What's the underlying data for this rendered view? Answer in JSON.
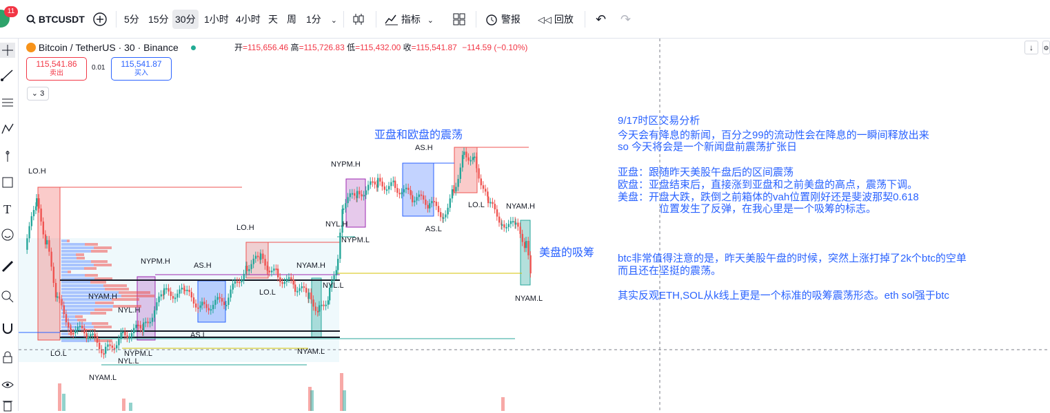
{
  "toolbar": {
    "notification_count": "11",
    "symbol": "BTCUSDT",
    "intervals": [
      "5分",
      "15分",
      "30分",
      "1小时",
      "4小时",
      "天",
      "周"
    ],
    "selected_interval": "30分",
    "interval_dropdown": "1分",
    "indicators_label": "指标",
    "alert_label": "警报",
    "replay_label": "回放"
  },
  "legend": {
    "pair": "Bitcoin / TetherUS · 30 · Binance",
    "open_label": "开",
    "open": "=115,656.46",
    "high_label": "高",
    "high": "=115,726.83",
    "low_label": "低",
    "low": "=115,432.00",
    "close_label": "收",
    "close": "=115,541.87",
    "change": "−114.59 (−0.10%)"
  },
  "trade": {
    "sell_price": "115,541.86",
    "sell_label": "卖出",
    "spread": "0.01",
    "buy_price": "115,541.87",
    "buy_label": "买入",
    "collapse_count": "3"
  },
  "annotations": {
    "chart_title": "亚盘和欧盘的震荡",
    "accumulation": "美盘的吸筹",
    "analysis": [
      "9/17时区交易分析",
      "今天会有降息的新闻，百分之99的流动性会在降息的一瞬间释放出来",
      "so 今天将会是一个新闻盘前震荡扩张日",
      "亚盘：跟随昨天美股午盘后的区间震荡",
      "欧盘：亚盘结束后，直接涨到亚盘和之前美盘的高点，震荡下调。",
      "美盘：开盘大跌，跌倒之前箱体的vah位置刚好还是斐波那契0.618",
      "位置发生了反弹，在我心里是一个吸筹的标志。",
      "btc非常值得注意的是，昨天美股午盘的时候，突然上涨打掉了2k个btc的空单",
      "而且还在坚挺的震荡。",
      "其实反观ETH,SOL从k线上更是一个标准的吸筹震荡形态。eth sol强于btc"
    ]
  },
  "session_labels": {
    "lo_h_1": "LO.H",
    "lo_l_1": "LO.L",
    "nyam_h_1": "NYAM.H",
    "nyl_h_1": "NYL.H",
    "nyam_l_1": "NYAM.L",
    "nypm_l_1": "NYPM.L",
    "nyl_l_1": "NYL.L",
    "nypm_h_1": "NYPM.H",
    "as_h_1": "AS.H",
    "as_l_1": "AS.L",
    "lo_h_2": "LO.H",
    "lo_l_2": "LO.L",
    "nyam_h_2": "NYAM.H",
    "nyl_l_2": "NYL.L",
    "nyam_l_2": "NYAM.L",
    "nypm_h_2": "NYPM.H",
    "nyl_h_2": "NYL.H",
    "nypm_l_2": "NYPM.L",
    "as_h_2": "AS.H",
    "as_l_2": "AS.L",
    "lo_l_3": "LO.L",
    "nyam_h_3": "NYAM.H",
    "nyam_l_3": "NYAM.L"
  },
  "colors": {
    "up": "#26a69a",
    "down": "#ef5350",
    "accent": "#2962ff",
    "text": "#131722"
  }
}
